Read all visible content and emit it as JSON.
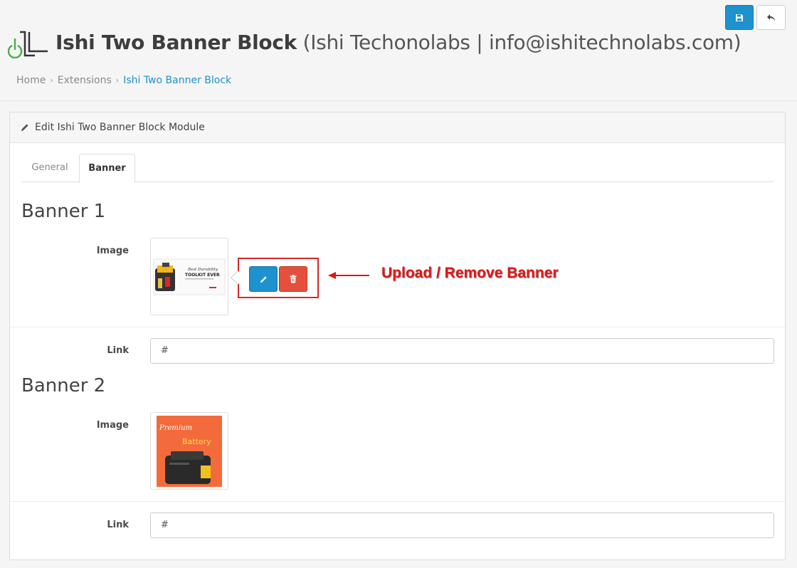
{
  "header": {
    "title_bold": "Ishi Two Banner Block",
    "title_light": "(Ishi Techonolabs | info@ishitechnolabs.com)",
    "save_icon": "save-icon",
    "back_icon": "reply-icon"
  },
  "breadcrumb": [
    "Home",
    "Extensions",
    "Ishi Two Banner Block"
  ],
  "panel": {
    "heading": "Edit Ishi Two Banner Block Module",
    "tabs": [
      "General",
      "Banner"
    ],
    "active_tab": "Banner"
  },
  "banner1": {
    "title": "Banner 1",
    "image_label": "Image",
    "link_label": "Link",
    "link_value": "#",
    "thumb_text_1": "Best Durability",
    "thumb_text_2": "TOOLKIT EVER"
  },
  "banner2": {
    "title": "Banner 2",
    "image_label": "Image",
    "link_label": "Link",
    "link_value": "#",
    "thumb_text_1": "Premium",
    "thumb_text_2": "Battery"
  },
  "annotation": {
    "text": "Upload / Remove Banner",
    "color": "#e01616"
  },
  "colors": {
    "primary": "#1e91cf",
    "danger": "#e3503e"
  }
}
